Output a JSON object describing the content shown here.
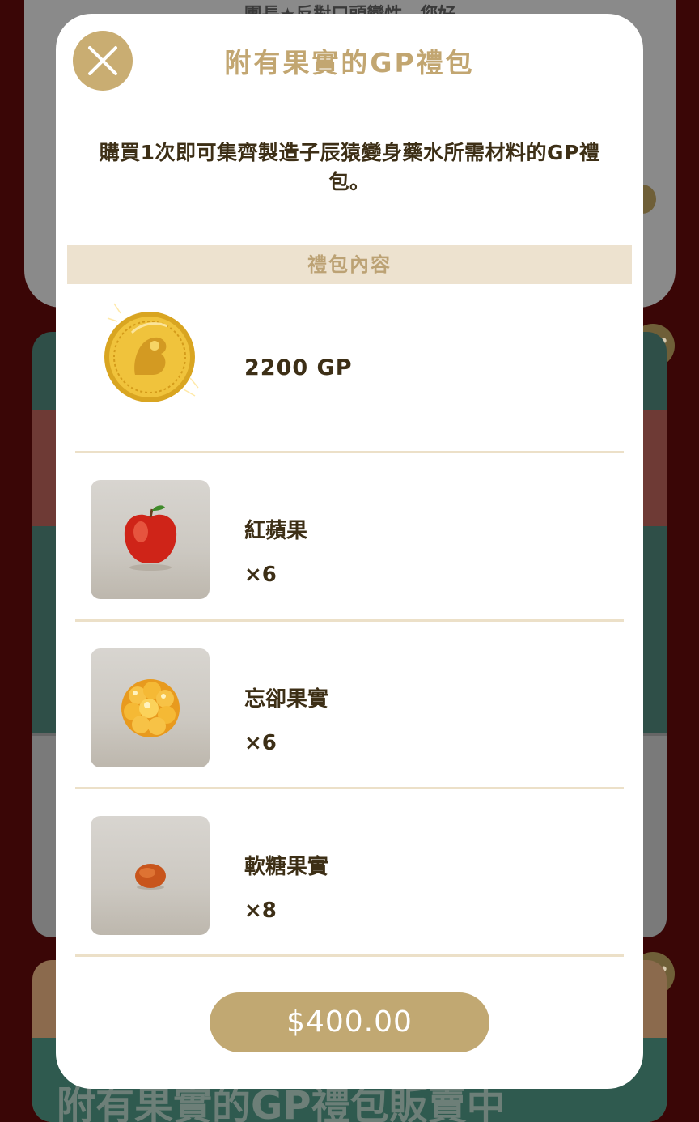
{
  "background": {
    "top_card_text": "團長★反對口頭變性、您好",
    "bottom_card_title": "附有果實的GP禮包販賣中",
    "more_label": "•••"
  },
  "modal": {
    "title": "附有果實的GP禮包",
    "description": "購買1次即可集齊製造子辰猿變身藥水所需材料的GP禮包。",
    "section_header": "禮包內容",
    "items": [
      {
        "name": "2200 GP",
        "quantity": "",
        "icon": "gold-coin-icon"
      },
      {
        "name": "紅蘋果",
        "quantity": "×6",
        "icon": "red-apple-icon"
      },
      {
        "name": "忘卻果實",
        "quantity": "×6",
        "icon": "forget-fruit-icon"
      },
      {
        "name": "軟糖果實",
        "quantity": "×8",
        "icon": "gummy-fruit-icon"
      }
    ],
    "price": "$400.00"
  },
  "colors": {
    "accent_gold": "#c1a872",
    "text_dark": "#3d2f16",
    "header_bg": "#ede2cf"
  }
}
